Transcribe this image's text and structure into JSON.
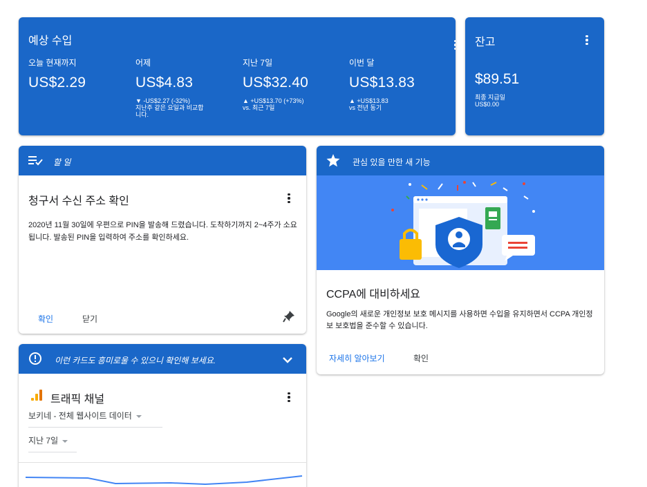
{
  "earnings": {
    "title": "예상 수입",
    "metrics": [
      {
        "label": "오늘 현재까지",
        "value": "US$2.29",
        "sub1": "",
        "sub2": "",
        "sub3": ""
      },
      {
        "label": "어제",
        "value": "US$4.83",
        "sub1": "▼ -US$2.27 (-32%)",
        "sub2": "지난주 같은 요일과 비교합",
        "sub3": "니다."
      },
      {
        "label": "지난 7일",
        "value": "US$32.40",
        "sub1": "▲ +US$13.70 (+73%)",
        "sub2": "vs. 최근 7일",
        "sub3": ""
      },
      {
        "label": "이번 달",
        "value": "US$13.83",
        "sub1": "▲ +US$13.83",
        "sub2": "vs 전년 동기",
        "sub3": ""
      }
    ]
  },
  "balance": {
    "title": "잔고",
    "value": "$89.51",
    "last_payment_label": "최종 지급일",
    "last_payment_value": "US$0.00"
  },
  "todo": {
    "header": "할 일",
    "card_title": "청구서 수신 주소 확인",
    "body": "2020년 11월 30일에 우편으로 PIN을 발송해 드렸습니다. 도착하기까지 2~4주가 소요됩니다. 발송된 PIN을 입력하여 주소를 확인하세요.",
    "confirm_label": "확인",
    "close_label": "닫기"
  },
  "feature": {
    "header": "관심 있을 만한 새 기능",
    "card_title": "CCPA에 대비하세요",
    "body": "Google의 새로운 개인정보 보호 메시지를 사용하면 수입을 유지하면서 CCPA 개인정보 보호법을 준수할 수 있습니다.",
    "learn_more_label": "자세히 알아보기",
    "confirm_label": "확인"
  },
  "suggest": {
    "header": "이런 카드도 흥미로울 수 있으니 확인해 보세요.",
    "card_title": "트래픽 채널",
    "site_select": "보키네 - 전체 웹사이트 데이터",
    "period_select": "지난 7일"
  },
  "colors": {
    "card_blue": "#1a67c8",
    "illustration_blue": "#4286f4",
    "link_blue": "#1a73e8"
  },
  "icons": {
    "todo_header": "checklist-icon",
    "feature_header": "star-icon",
    "suggest_header": "alert-circle-icon",
    "pin": "pin-icon",
    "traffic": "bar-chart-icon"
  }
}
